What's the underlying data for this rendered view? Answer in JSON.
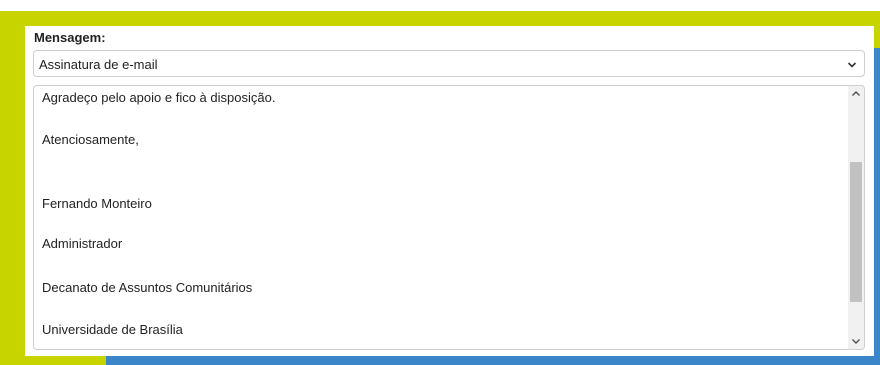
{
  "form": {
    "label": "Mensagem:",
    "select": {
      "value": "Assinatura de e-mail"
    },
    "textarea": {
      "lines": [
        "Agradeço pelo apoio e fico à disposição.",
        "Atenciosamente,",
        "Fernando Monteiro",
        "Administrador",
        "Decanato de Assuntos Comunitários",
        "Universidade de Brasília"
      ]
    }
  },
  "icons": {
    "select": "chevron-down-icon",
    "scroll_up": "scroll-up-arrow-icon",
    "scroll_down": "scroll-down-arrow-icon"
  },
  "colors": {
    "accent_yellow": "#c8d400",
    "accent_blue": "#3b86c8",
    "scroll_thumb": "#c1c1c1"
  }
}
